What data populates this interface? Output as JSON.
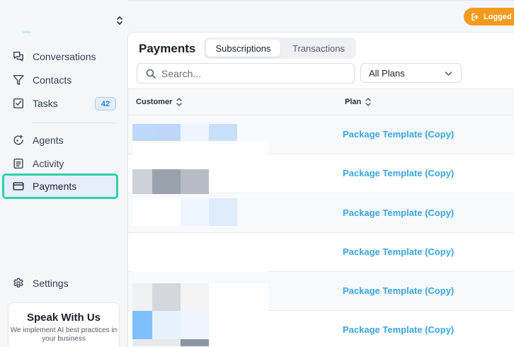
{
  "sidebar": {
    "nav": [
      {
        "label": "Conversations",
        "icon": "conversations-icon"
      },
      {
        "label": "Contacts",
        "icon": "filter-icon"
      },
      {
        "label": "Tasks",
        "icon": "checkbox-icon",
        "badge": "42"
      },
      {
        "label": "Agents",
        "icon": "agents-icon"
      },
      {
        "label": "Activity",
        "icon": "activity-icon"
      },
      {
        "label": "Payments",
        "icon": "credit-card-icon",
        "active": true
      },
      {
        "label": "Settings",
        "icon": "gear-icon"
      }
    ],
    "promo": {
      "title": "Speak With Us",
      "subtitle": "We implement AI best practices in your business"
    }
  },
  "topbar": {
    "status_label": "Logged"
  },
  "main": {
    "title": "Payments",
    "tabs": [
      {
        "label": "Subscriptions",
        "selected": true
      },
      {
        "label": "Transactions",
        "selected": false
      }
    ],
    "search": {
      "placeholder": "Search..."
    },
    "plan_filter": {
      "value": "All Plans"
    },
    "table": {
      "columns": [
        "Customer",
        "Plan"
      ],
      "rows": [
        {
          "plan": "Package Template (Copy)"
        },
        {
          "plan": "Package Template (Copy)"
        },
        {
          "plan": "Package Template (Copy)"
        },
        {
          "plan": "Package Template (Copy)"
        },
        {
          "plan": "Package Template (Copy)"
        },
        {
          "plan": "Package Template (Copy)"
        }
      ]
    }
  },
  "colors": {
    "accent_orange": "#f49a1c",
    "active_outline": "#2bd3a6",
    "link_blue": "#3aa6df",
    "badge_blue": "#2b7fd9"
  }
}
